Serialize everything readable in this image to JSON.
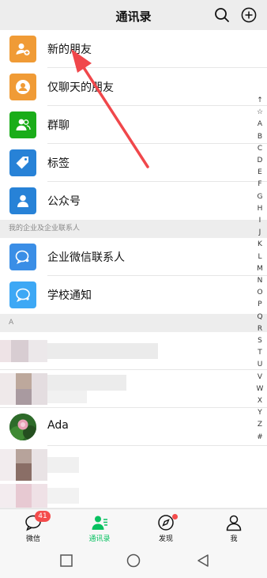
{
  "header": {
    "title": "通讯录"
  },
  "menu": [
    {
      "label": "新的朋友",
      "color": "#f09b36"
    },
    {
      "label": "仅聊天的朋友",
      "color": "#f09b36"
    },
    {
      "label": "群聊",
      "color": "#1aad19"
    },
    {
      "label": "标签",
      "color": "#2782d7"
    },
    {
      "label": "公众号",
      "color": "#2782d7"
    }
  ],
  "enterprise": {
    "header": "我的企业及企业联系人",
    "items": [
      {
        "label": "企业微信联系人",
        "color": "#3a8ee6"
      },
      {
        "label": "学校通知",
        "color": "#3da8f5"
      }
    ]
  },
  "contacts": {
    "section_letter": "A",
    "named_contact": "Ada"
  },
  "index_letters": [
    "↑",
    "☆",
    "A",
    "B",
    "C",
    "D",
    "E",
    "F",
    "G",
    "H",
    "I",
    "J",
    "K",
    "L",
    "M",
    "N",
    "O",
    "P",
    "Q",
    "R",
    "S",
    "T",
    "U",
    "V",
    "W",
    "X",
    "Y",
    "Z",
    "#"
  ],
  "tabs": [
    {
      "label": "微信",
      "badge": "41",
      "active": false
    },
    {
      "label": "通讯录",
      "active": true
    },
    {
      "label": "发现",
      "dot": true,
      "active": false
    },
    {
      "label": "我",
      "active": false
    }
  ],
  "colors": {
    "accent": "#07c160",
    "badge": "#f44c4c",
    "arrow": "#f0474b"
  }
}
